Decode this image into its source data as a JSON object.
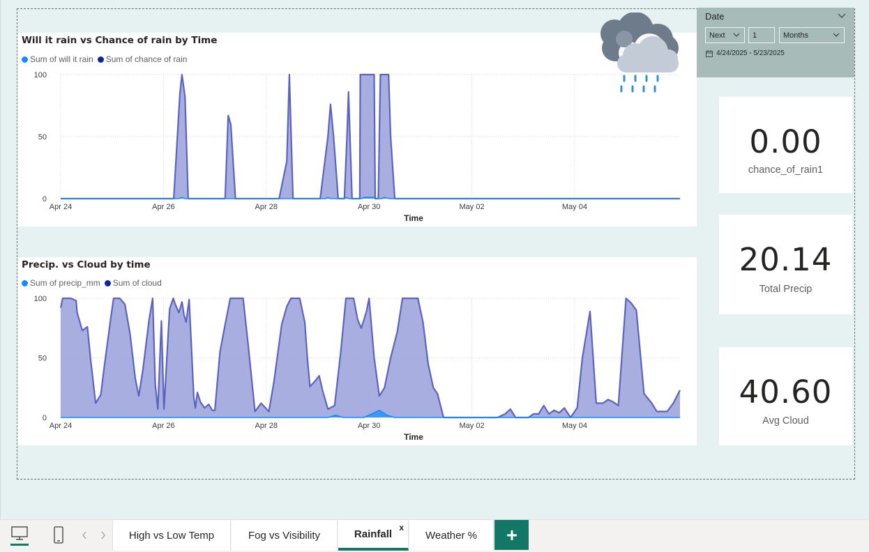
{
  "charts": {
    "rain": {
      "title": "Will it rain vs Chance of rain by Time",
      "legend": [
        {
          "label": "Sum of will it rain",
          "color": "#118DFF"
        },
        {
          "label": "Sum of chance of rain",
          "color": "#12239E"
        }
      ],
      "xlabel": "Time",
      "yticks": [
        "100",
        "50",
        "0"
      ],
      "xticks": [
        "Apr 24",
        "Apr 26",
        "Apr 28",
        "Apr 30",
        "May 02",
        "May 04"
      ]
    },
    "precip": {
      "title": "Precip. vs Cloud by time",
      "legend": [
        {
          "label": "Sum of precip_mm",
          "color": "#118DFF"
        },
        {
          "label": "Sum of cloud",
          "color": "#12239E"
        }
      ],
      "xlabel": "Time",
      "yticks": [
        "100",
        "50",
        "0"
      ],
      "xticks": [
        "Apr 24",
        "Apr 26",
        "Apr 28",
        "Apr 30",
        "May 02",
        "May 04"
      ]
    }
  },
  "chart_data": [
    {
      "type": "area",
      "title": "Will it rain vs Chance of rain by Time",
      "xlabel": "Time",
      "ylabel": "",
      "ylim": [
        0,
        100
      ],
      "xlim_days": [
        0,
        12.05
      ],
      "x_start_label": "Apr 24",
      "grid": true,
      "legend_position": "top-left",
      "series": [
        {
          "name": "Sum of chance of rain",
          "color": "#5b63be",
          "points": [
            [
              0,
              0
            ],
            [
              2.2,
              0
            ],
            [
              2.32,
              85
            ],
            [
              2.36,
              100
            ],
            [
              2.42,
              82
            ],
            [
              2.48,
              0
            ],
            [
              3.2,
              0
            ],
            [
              3.26,
              67
            ],
            [
              3.31,
              60
            ],
            [
              3.4,
              0
            ],
            [
              4.25,
              0
            ],
            [
              4.4,
              30
            ],
            [
              4.45,
              100
            ],
            [
              4.52,
              0
            ],
            [
              5.05,
              0
            ],
            [
              5.2,
              50
            ],
            [
              5.25,
              76
            ],
            [
              5.31,
              50
            ],
            [
              5.4,
              0
            ],
            [
              5.52,
              0
            ],
            [
              5.57,
              50
            ],
            [
              5.6,
              86
            ],
            [
              5.67,
              0
            ],
            [
              5.66,
              0
            ],
            [
              5.72,
              0
            ],
            [
              5.78,
              0
            ],
            [
              5.82,
              0
            ],
            [
              5.83,
              100
            ],
            [
              6.1,
              100
            ],
            [
              6.12,
              0
            ],
            [
              6.18,
              0
            ],
            [
              6.22,
              100
            ],
            [
              6.38,
              100
            ],
            [
              6.42,
              50
            ],
            [
              6.5,
              0
            ],
            [
              12.05,
              0
            ]
          ]
        },
        {
          "name": "Sum of will it rain",
          "color": "#118DFF",
          "points": [
            [
              0,
              0
            ],
            [
              2.3,
              0
            ],
            [
              2.35,
              1
            ],
            [
              2.42,
              0
            ],
            [
              5.15,
              0
            ],
            [
              5.2,
              1
            ],
            [
              5.25,
              0
            ],
            [
              5.5,
              0
            ],
            [
              5.55,
              1
            ],
            [
              5.6,
              0
            ],
            [
              5.85,
              0
            ],
            [
              5.9,
              1
            ],
            [
              6.1,
              1
            ],
            [
              6.15,
              0
            ],
            [
              6.25,
              0
            ],
            [
              6.3,
              1
            ],
            [
              6.4,
              0
            ],
            [
              12.05,
              0
            ]
          ]
        }
      ]
    },
    {
      "type": "area",
      "title": "Precip. vs Cloud by time",
      "xlabel": "Time",
      "ylabel": "",
      "ylim": [
        0,
        100
      ],
      "xlim_days": [
        0,
        12.05
      ],
      "x_start_label": "Apr 24",
      "grid": true,
      "legend_position": "top-left",
      "series": [
        {
          "name": "Sum of cloud",
          "color": "#5b63be",
          "points": [
            [
              0,
              92
            ],
            [
              0.04,
              100
            ],
            [
              0.2,
              100
            ],
            [
              0.3,
              98
            ],
            [
              0.32,
              88
            ],
            [
              0.42,
              73
            ],
            [
              0.52,
              76
            ],
            [
              0.58,
              50
            ],
            [
              0.68,
              12
            ],
            [
              0.78,
              19
            ],
            [
              0.85,
              43
            ],
            [
              0.98,
              85
            ],
            [
              1.03,
              100
            ],
            [
              1.15,
              100
            ],
            [
              1.25,
              95
            ],
            [
              1.35,
              70
            ],
            [
              1.45,
              33
            ],
            [
              1.52,
              18
            ],
            [
              1.6,
              40
            ],
            [
              1.72,
              82
            ],
            [
              1.79,
              100
            ],
            [
              1.84,
              28
            ],
            [
              1.89,
              7
            ],
            [
              1.96,
              81
            ],
            [
              2.01,
              7
            ],
            [
              2.12,
              91
            ],
            [
              2.19,
              100
            ],
            [
              2.23,
              95
            ],
            [
              2.3,
              88
            ],
            [
              2.36,
              97
            ],
            [
              2.4,
              86
            ],
            [
              2.44,
              80
            ],
            [
              2.5,
              99
            ],
            [
              2.59,
              17
            ],
            [
              2.62,
              8
            ],
            [
              2.66,
              21
            ],
            [
              2.72,
              13
            ],
            [
              2.8,
              8
            ],
            [
              2.88,
              11
            ],
            [
              2.95,
              6
            ],
            [
              3.0,
              6
            ],
            [
              3.1,
              55
            ],
            [
              3.2,
              78
            ],
            [
              3.3,
              100
            ],
            [
              3.55,
              100
            ],
            [
              3.65,
              60
            ],
            [
              3.78,
              5
            ],
            [
              3.9,
              12
            ],
            [
              4.05,
              5
            ],
            [
              4.15,
              30
            ],
            [
              4.3,
              78
            ],
            [
              4.4,
              93
            ],
            [
              4.48,
              100
            ],
            [
              4.65,
              100
            ],
            [
              4.75,
              80
            ],
            [
              4.8,
              50
            ],
            [
              4.85,
              26
            ],
            [
              4.94,
              30
            ],
            [
              5.03,
              35
            ],
            [
              5.1,
              22
            ],
            [
              5.2,
              7
            ],
            [
              5.33,
              10
            ],
            [
              5.45,
              55
            ],
            [
              5.55,
              100
            ],
            [
              5.7,
              100
            ],
            [
              5.78,
              82
            ],
            [
              5.85,
              75
            ],
            [
              5.95,
              89
            ],
            [
              6.0,
              100
            ],
            [
              6.1,
              50
            ],
            [
              6.2,
              18
            ],
            [
              6.3,
              25
            ],
            [
              6.42,
              50
            ],
            [
              6.55,
              72
            ],
            [
              6.65,
              100
            ],
            [
              6.95,
              100
            ],
            [
              7.05,
              80
            ],
            [
              7.15,
              45
            ],
            [
              7.25,
              25
            ],
            [
              7.33,
              20
            ],
            [
              7.45,
              0
            ],
            [
              8.5,
              0
            ],
            [
              8.65,
              3
            ],
            [
              8.75,
              7
            ],
            [
              8.85,
              0
            ],
            [
              9.1,
              0
            ],
            [
              9.2,
              3
            ],
            [
              9.3,
              3
            ],
            [
              9.4,
              10
            ],
            [
              9.5,
              3
            ],
            [
              9.6,
              6
            ],
            [
              9.7,
              4
            ],
            [
              9.8,
              8
            ],
            [
              9.92,
              0
            ],
            [
              10.05,
              8
            ],
            [
              10.15,
              50
            ],
            [
              10.3,
              89
            ],
            [
              10.42,
              12
            ],
            [
              10.55,
              12
            ],
            [
              10.65,
              15
            ],
            [
              10.75,
              13
            ],
            [
              10.85,
              10
            ],
            [
              11.0,
              100
            ],
            [
              11.1,
              96
            ],
            [
              11.2,
              90
            ],
            [
              11.35,
              20
            ],
            [
              11.5,
              12
            ],
            [
              11.6,
              5
            ],
            [
              11.8,
              5
            ],
            [
              11.92,
              12
            ],
            [
              12.05,
              23
            ]
          ]
        },
        {
          "name": "Sum of precip_mm",
          "color": "#118DFF",
          "points": [
            [
              0,
              0
            ],
            [
              5.2,
              0
            ],
            [
              5.35,
              2
            ],
            [
              5.5,
              0
            ],
            [
              5.9,
              0
            ],
            [
              6.05,
              3
            ],
            [
              6.2,
              6
            ],
            [
              6.35,
              2
            ],
            [
              6.5,
              0
            ],
            [
              12.05,
              0
            ]
          ]
        }
      ]
    }
  ],
  "slicer": {
    "title": "Date",
    "relative": "Next",
    "count": "1",
    "unit": "Months",
    "range": "4/24/2025 - 5/23/2025"
  },
  "cards": [
    {
      "value": "0.00",
      "label": "chance_of_rain1"
    },
    {
      "value": "20.14",
      "label": "Total Precip"
    },
    {
      "value": "40.60",
      "label": "Avg Cloud"
    }
  ],
  "tabs": [
    {
      "label": "High vs Low Temp",
      "active": false
    },
    {
      "label": "Fog vs Visibility",
      "active": false
    },
    {
      "label": "Rainfall",
      "active": true,
      "close": "x"
    },
    {
      "label": "Weather %",
      "active": false
    }
  ],
  "colors": {
    "accent": "#117865",
    "area_fill": "#9aa0da",
    "area_line": "#5b63be",
    "slicer_bg": "#a7bbb8",
    "canvas_bg": "#e6f2f2"
  },
  "icons": [
    "desktop-view-icon",
    "mobile-view-icon",
    "prev-page-icon",
    "next-page-icon",
    "add-page-icon",
    "rain-cloud-icon",
    "calendar-icon",
    "chevron-down-icon"
  ]
}
